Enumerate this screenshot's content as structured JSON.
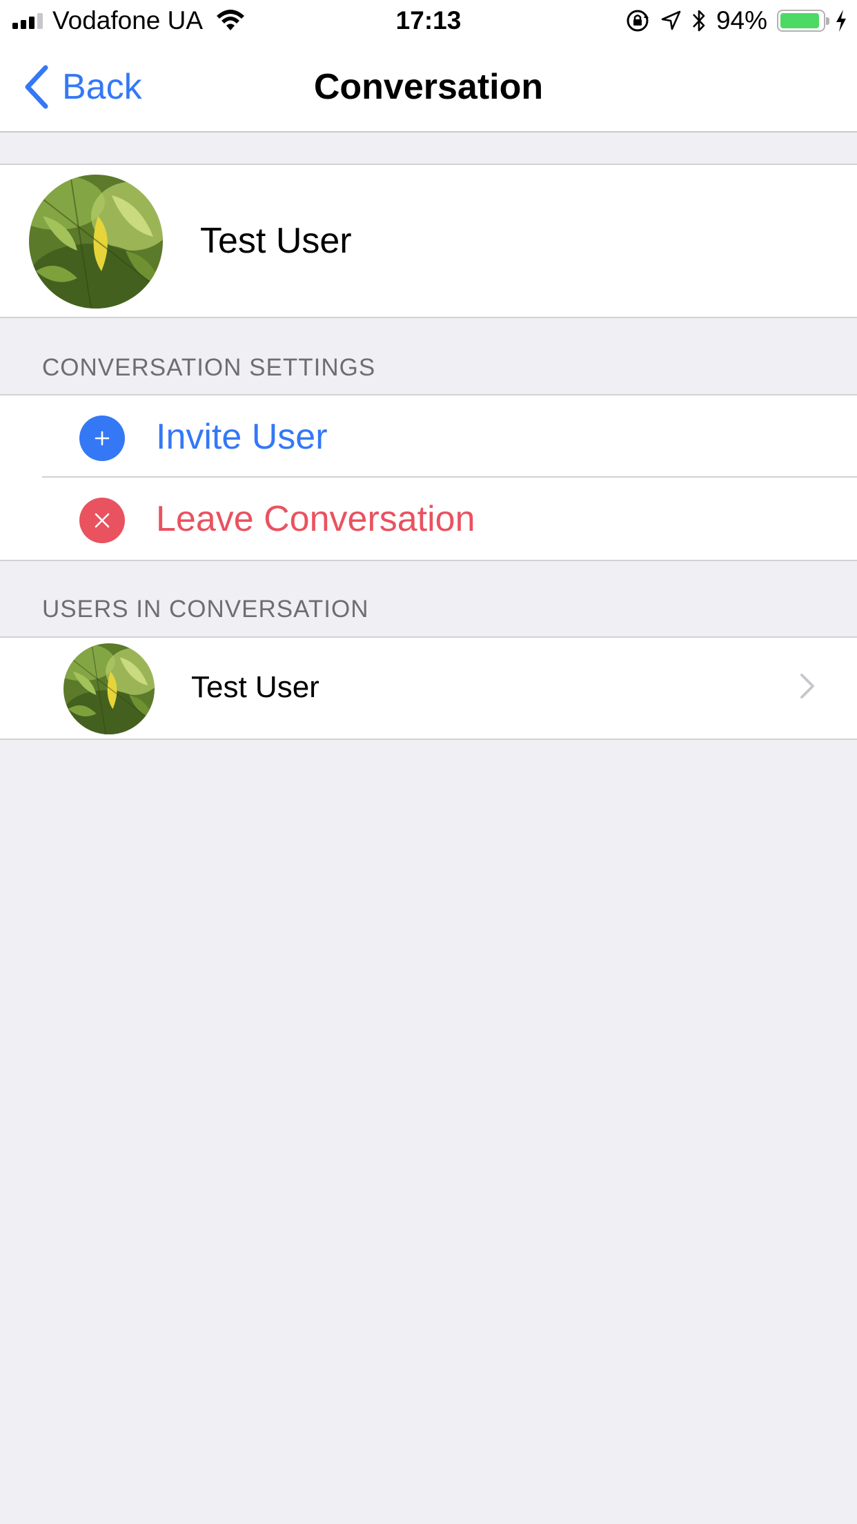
{
  "status_bar": {
    "carrier": "Vodafone UA",
    "time": "17:13",
    "battery_percent": "94%",
    "battery_level": 0.94,
    "signal_bars_active": 3,
    "signal_bars_total": 4,
    "icons": [
      "signal-icon",
      "wifi-icon",
      "rotation-lock-icon",
      "location-arrow-icon",
      "bluetooth-icon",
      "battery-icon",
      "charging-bolt-icon"
    ]
  },
  "nav": {
    "back_label": "Back",
    "title": "Conversation"
  },
  "profile": {
    "name": "Test User"
  },
  "settings": {
    "header": "CONVERSATION SETTINGS",
    "items": [
      {
        "label": "Invite User",
        "icon": "plus-icon",
        "color": "#3478f6"
      },
      {
        "label": "Leave Conversation",
        "icon": "close-icon",
        "color": "#e9525f"
      }
    ]
  },
  "users": {
    "header": "USERS IN CONVERSATION",
    "items": [
      {
        "name": "Test User"
      }
    ]
  },
  "colors": {
    "accent": "#3478f6",
    "destructive": "#e9525f",
    "background": "#efeff4",
    "separator": "#d1d1d6",
    "section_text": "#6d6d72"
  }
}
